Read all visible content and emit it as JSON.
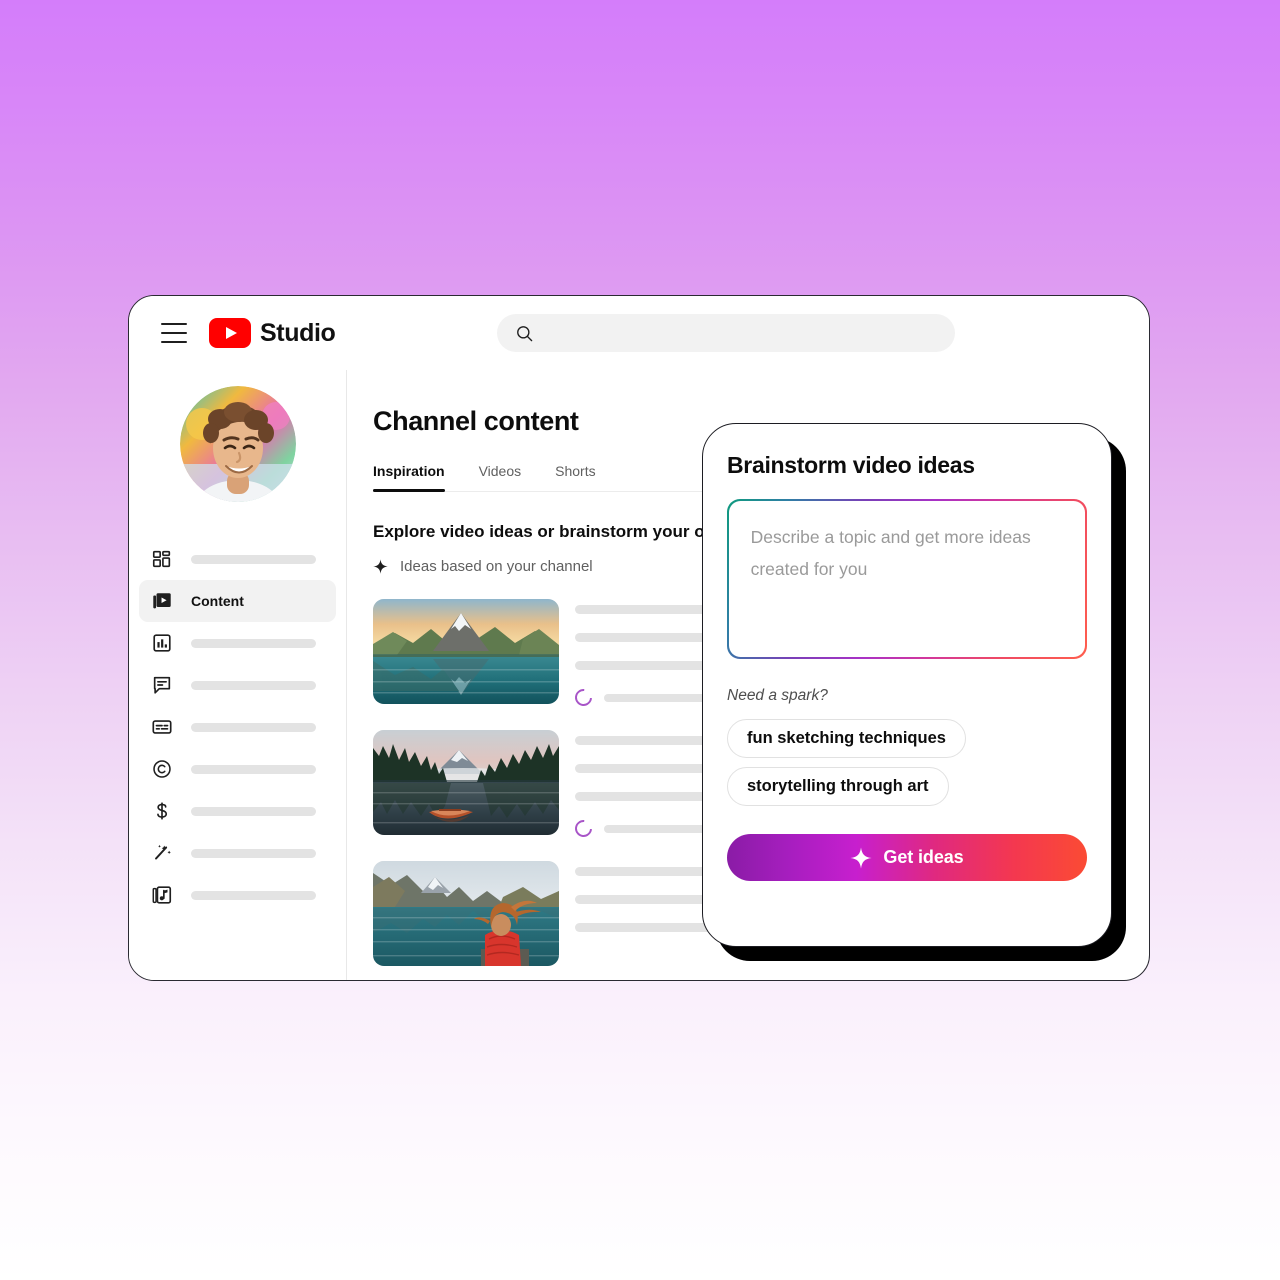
{
  "background": {
    "gradient_top": "#d47dfa",
    "gradient_bottom": "#ffffff"
  },
  "window": {
    "topbar": {
      "menu_icon": "hamburger-menu-icon",
      "logo_icon": "youtube-play-logo",
      "brand_name": "Studio",
      "brand_color": "#ff0000",
      "search": {
        "icon": "search-icon",
        "value": "",
        "placeholder": ""
      }
    },
    "sidebar": {
      "avatar_alt": "channel-avatar",
      "items": [
        {
          "icon": "dashboard-icon",
          "label": "",
          "active": false
        },
        {
          "icon": "content-video-icon",
          "label": "Content",
          "active": true
        },
        {
          "icon": "analytics-icon",
          "label": "",
          "active": false
        },
        {
          "icon": "comments-icon",
          "label": "",
          "active": false
        },
        {
          "icon": "subtitles-icon",
          "label": "",
          "active": false
        },
        {
          "icon": "copyright-icon",
          "label": "",
          "active": false
        },
        {
          "icon": "earn-dollar-icon",
          "label": "",
          "active": false
        },
        {
          "icon": "customization-wand-icon",
          "label": "",
          "active": false
        },
        {
          "icon": "audio-library-icon",
          "label": "",
          "active": false
        }
      ]
    },
    "main": {
      "page_title": "Channel content",
      "tabs": [
        {
          "label": "Inspiration",
          "active": true
        },
        {
          "label": "Videos",
          "active": false
        },
        {
          "label": "Shorts",
          "active": false
        }
      ],
      "explore_heading": "Explore video ideas or brainstorm your own",
      "ideas_section": {
        "icon": "sparkle-icon",
        "label": "Ideas based on your channel"
      },
      "idea_cards": [
        {
          "thumbnail": "matterhorn-lake-sunrise-thumbnail",
          "metric_icon": "progress-ring-icon"
        },
        {
          "thumbnail": "forest-lake-rowboat-thumbnail",
          "metric_icon": "progress-ring-icon"
        },
        {
          "thumbnail": "red-jacket-woman-mountain-lake-thumbnail",
          "metric_icon": ""
        }
      ]
    }
  },
  "modal": {
    "title": "Brainstorm video ideas",
    "textarea": {
      "value": "",
      "placeholder": "Describe a topic and get more ideas created for you",
      "border_gradient_from": "#0f9b7e",
      "border_gradient_mid": "#a832c6",
      "border_gradient_to": "#ff5e4d"
    },
    "spark_label": "Need a spark?",
    "suggestion_chips": [
      "fun sketching techniques",
      "storytelling through art"
    ],
    "primary_button": {
      "icon": "sparkle-icon",
      "label": "Get ideas",
      "gradient_from": "#8a1ca6",
      "gradient_to": "#fb4b34"
    }
  }
}
